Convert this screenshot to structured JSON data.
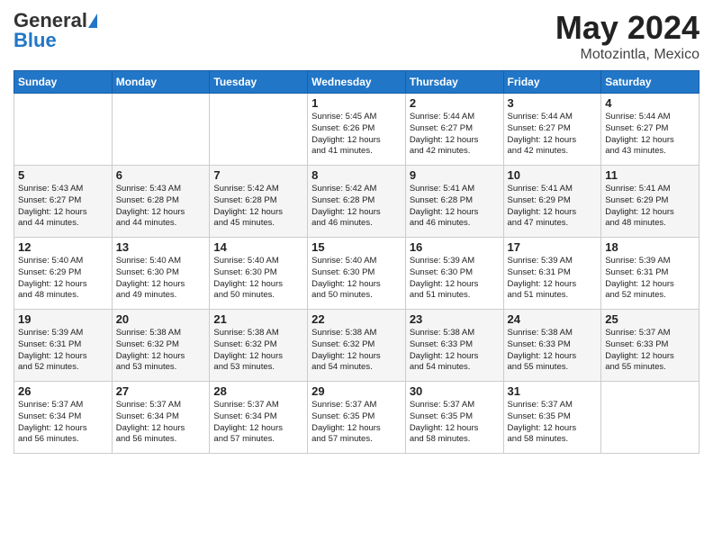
{
  "header": {
    "logo_general": "General",
    "logo_blue": "Blue",
    "title": "May 2024",
    "location": "Motozintla, Mexico"
  },
  "days_of_week": [
    "Sunday",
    "Monday",
    "Tuesday",
    "Wednesday",
    "Thursday",
    "Friday",
    "Saturday"
  ],
  "weeks": [
    [
      {
        "day": "",
        "info": ""
      },
      {
        "day": "",
        "info": ""
      },
      {
        "day": "",
        "info": ""
      },
      {
        "day": "1",
        "info": "Sunrise: 5:45 AM\nSunset: 6:26 PM\nDaylight: 12 hours\nand 41 minutes."
      },
      {
        "day": "2",
        "info": "Sunrise: 5:44 AM\nSunset: 6:27 PM\nDaylight: 12 hours\nand 42 minutes."
      },
      {
        "day": "3",
        "info": "Sunrise: 5:44 AM\nSunset: 6:27 PM\nDaylight: 12 hours\nand 42 minutes."
      },
      {
        "day": "4",
        "info": "Sunrise: 5:44 AM\nSunset: 6:27 PM\nDaylight: 12 hours\nand 43 minutes."
      }
    ],
    [
      {
        "day": "5",
        "info": "Sunrise: 5:43 AM\nSunset: 6:27 PM\nDaylight: 12 hours\nand 44 minutes."
      },
      {
        "day": "6",
        "info": "Sunrise: 5:43 AM\nSunset: 6:28 PM\nDaylight: 12 hours\nand 44 minutes."
      },
      {
        "day": "7",
        "info": "Sunrise: 5:42 AM\nSunset: 6:28 PM\nDaylight: 12 hours\nand 45 minutes."
      },
      {
        "day": "8",
        "info": "Sunrise: 5:42 AM\nSunset: 6:28 PM\nDaylight: 12 hours\nand 46 minutes."
      },
      {
        "day": "9",
        "info": "Sunrise: 5:41 AM\nSunset: 6:28 PM\nDaylight: 12 hours\nand 46 minutes."
      },
      {
        "day": "10",
        "info": "Sunrise: 5:41 AM\nSunset: 6:29 PM\nDaylight: 12 hours\nand 47 minutes."
      },
      {
        "day": "11",
        "info": "Sunrise: 5:41 AM\nSunset: 6:29 PM\nDaylight: 12 hours\nand 48 minutes."
      }
    ],
    [
      {
        "day": "12",
        "info": "Sunrise: 5:40 AM\nSunset: 6:29 PM\nDaylight: 12 hours\nand 48 minutes."
      },
      {
        "day": "13",
        "info": "Sunrise: 5:40 AM\nSunset: 6:30 PM\nDaylight: 12 hours\nand 49 minutes."
      },
      {
        "day": "14",
        "info": "Sunrise: 5:40 AM\nSunset: 6:30 PM\nDaylight: 12 hours\nand 50 minutes."
      },
      {
        "day": "15",
        "info": "Sunrise: 5:40 AM\nSunset: 6:30 PM\nDaylight: 12 hours\nand 50 minutes."
      },
      {
        "day": "16",
        "info": "Sunrise: 5:39 AM\nSunset: 6:30 PM\nDaylight: 12 hours\nand 51 minutes."
      },
      {
        "day": "17",
        "info": "Sunrise: 5:39 AM\nSunset: 6:31 PM\nDaylight: 12 hours\nand 51 minutes."
      },
      {
        "day": "18",
        "info": "Sunrise: 5:39 AM\nSunset: 6:31 PM\nDaylight: 12 hours\nand 52 minutes."
      }
    ],
    [
      {
        "day": "19",
        "info": "Sunrise: 5:39 AM\nSunset: 6:31 PM\nDaylight: 12 hours\nand 52 minutes."
      },
      {
        "day": "20",
        "info": "Sunrise: 5:38 AM\nSunset: 6:32 PM\nDaylight: 12 hours\nand 53 minutes."
      },
      {
        "day": "21",
        "info": "Sunrise: 5:38 AM\nSunset: 6:32 PM\nDaylight: 12 hours\nand 53 minutes."
      },
      {
        "day": "22",
        "info": "Sunrise: 5:38 AM\nSunset: 6:32 PM\nDaylight: 12 hours\nand 54 minutes."
      },
      {
        "day": "23",
        "info": "Sunrise: 5:38 AM\nSunset: 6:33 PM\nDaylight: 12 hours\nand 54 minutes."
      },
      {
        "day": "24",
        "info": "Sunrise: 5:38 AM\nSunset: 6:33 PM\nDaylight: 12 hours\nand 55 minutes."
      },
      {
        "day": "25",
        "info": "Sunrise: 5:37 AM\nSunset: 6:33 PM\nDaylight: 12 hours\nand 55 minutes."
      }
    ],
    [
      {
        "day": "26",
        "info": "Sunrise: 5:37 AM\nSunset: 6:34 PM\nDaylight: 12 hours\nand 56 minutes."
      },
      {
        "day": "27",
        "info": "Sunrise: 5:37 AM\nSunset: 6:34 PM\nDaylight: 12 hours\nand 56 minutes."
      },
      {
        "day": "28",
        "info": "Sunrise: 5:37 AM\nSunset: 6:34 PM\nDaylight: 12 hours\nand 57 minutes."
      },
      {
        "day": "29",
        "info": "Sunrise: 5:37 AM\nSunset: 6:35 PM\nDaylight: 12 hours\nand 57 minutes."
      },
      {
        "day": "30",
        "info": "Sunrise: 5:37 AM\nSunset: 6:35 PM\nDaylight: 12 hours\nand 58 minutes."
      },
      {
        "day": "31",
        "info": "Sunrise: 5:37 AM\nSunset: 6:35 PM\nDaylight: 12 hours\nand 58 minutes."
      },
      {
        "day": "",
        "info": ""
      }
    ]
  ]
}
